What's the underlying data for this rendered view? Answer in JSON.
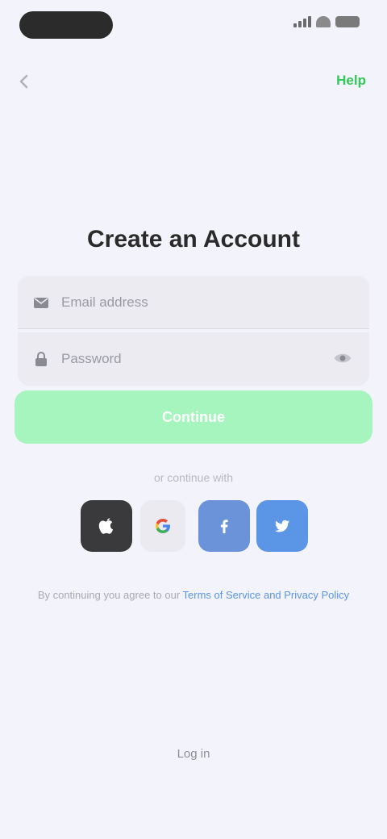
{
  "status_bar": {
    "time_pill": ""
  },
  "nav": {
    "action_label": "Help"
  },
  "title": "Create an Account",
  "form": {
    "email_placeholder": "Email address",
    "password_placeholder": "Password",
    "continue_label": "Continue"
  },
  "divider_text": "or continue with",
  "social": [
    {
      "name": "apple",
      "color": "#3a3a3c"
    },
    {
      "name": "google",
      "color": "#eaeaf0"
    },
    {
      "name": "facebook",
      "color": "#6a93d9"
    },
    {
      "name": "twitter",
      "color": "#5b95e6"
    }
  ],
  "terms": {
    "prefix": "By continuing you agree to our",
    "link": "Terms of Service and Privacy Policy",
    "suffix": ""
  },
  "bottom_link": "Log in",
  "colors": {
    "accent": "#34c759",
    "button_disabled": "#a6f5bf",
    "background": "#f3f3fb"
  }
}
